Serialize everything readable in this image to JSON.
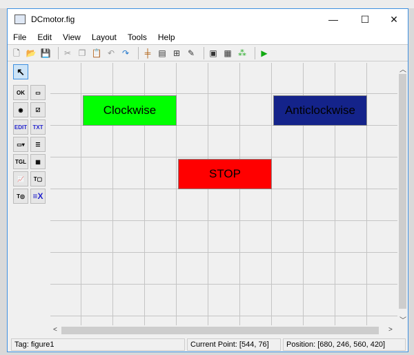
{
  "window": {
    "title": "DCmotor.fig",
    "minimize": "—",
    "maximize": "☐",
    "close": "✕"
  },
  "menu": [
    "File",
    "Edit",
    "View",
    "Layout",
    "Tools",
    "Help"
  ],
  "toolbar": [
    {
      "name": "new-icon",
      "g": "🗋",
      "c": "#444"
    },
    {
      "name": "open-icon",
      "g": "📂",
      "c": "#c90"
    },
    {
      "name": "save-icon",
      "g": "💾",
      "c": "#347"
    },
    "sep",
    {
      "name": "cut-icon",
      "g": "✂",
      "c": "#999"
    },
    {
      "name": "copy-icon",
      "g": "❐",
      "c": "#999"
    },
    {
      "name": "paste-icon",
      "g": "📋",
      "c": "#999"
    },
    {
      "name": "undo-icon",
      "g": "↶",
      "c": "#999"
    },
    {
      "name": "redo-icon",
      "g": "↷",
      "c": "#27c"
    },
    "sep",
    {
      "name": "align-icon",
      "g": "╪",
      "c": "#a50"
    },
    {
      "name": "menu-editor-icon",
      "g": "▤",
      "c": "#333"
    },
    {
      "name": "tab-order-icon",
      "g": "⊞",
      "c": "#333"
    },
    {
      "name": "toolbar-editor-icon",
      "g": "✎",
      "c": "#333"
    },
    "sep",
    {
      "name": "editor-icon",
      "g": "▣",
      "c": "#333"
    },
    {
      "name": "property-inspector-icon",
      "g": "▦",
      "c": "#333"
    },
    {
      "name": "object-browser-icon",
      "g": "⁂",
      "c": "#2a2"
    },
    "sep",
    {
      "name": "run-icon",
      "g": "▶",
      "c": "#1a1"
    }
  ],
  "palette": [
    {
      "name": "select-tool",
      "g": "↖"
    },
    {
      "name": "push-button-tool",
      "g": "OK"
    },
    {
      "name": "slider-tool",
      "g": "▭"
    },
    {
      "name": "radio-button-tool",
      "g": "◉"
    },
    {
      "name": "checkbox-tool",
      "g": "☑"
    },
    {
      "name": "edit-text-tool",
      "g": "EDIT"
    },
    {
      "name": "static-text-tool",
      "g": "TXT"
    },
    {
      "name": "popup-menu-tool",
      "g": "▭▾"
    },
    {
      "name": "listbox-tool",
      "g": "☰"
    },
    {
      "name": "toggle-button-tool",
      "g": "TGL"
    },
    {
      "name": "table-tool",
      "g": "▦"
    },
    {
      "name": "axes-tool",
      "g": "📈"
    },
    {
      "name": "panel-tool",
      "g": "T▢"
    },
    {
      "name": "button-group-tool",
      "g": "T◎"
    },
    {
      "name": "activex-tool",
      "g": "≡X"
    }
  ],
  "buttons": [
    {
      "label": "Clockwise",
      "color": "#00ff00"
    },
    {
      "label": "Anticlockwise",
      "color": "#14238a"
    },
    {
      "label": "STOP",
      "color": "#ff0000"
    }
  ],
  "status": {
    "tag": "Tag: figure1",
    "current_point": "Current Point:  [544, 76]",
    "position": "Position: [680, 246, 560, 420]"
  }
}
